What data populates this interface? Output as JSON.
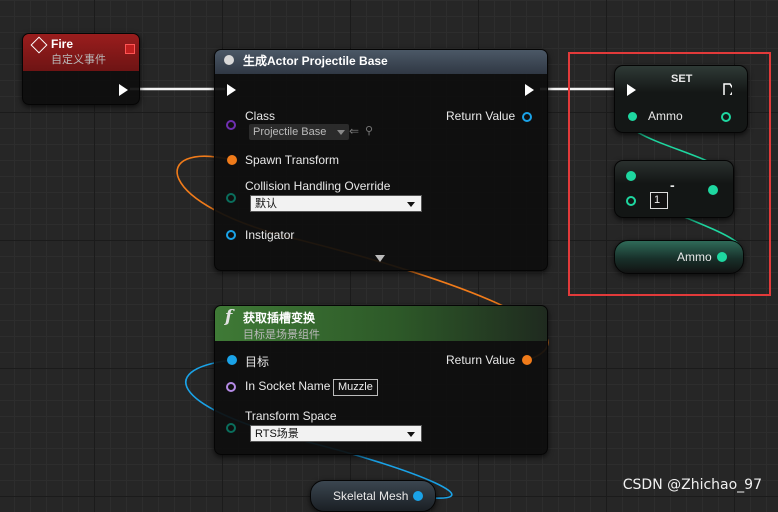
{
  "fire_node": {
    "title": "Fire",
    "subtitle": "自定义事件"
  },
  "spawn_node": {
    "title": "生成Actor Projectile Base",
    "class_label": "Class",
    "class_value": "Projectile Base",
    "return_label": "Return Value",
    "spawn_transform_label": "Spawn Transform",
    "collision_label": "Collision Handling Override",
    "collision_value": "默认",
    "instigator_label": "Instigator"
  },
  "socket_node": {
    "title": "获取插槽变换",
    "subtitle": "目标是场景组件",
    "target_label": "目标",
    "return_label": "Return Value",
    "socket_label": "In Socket Name",
    "socket_value": "Muzzle",
    "transform_label": "Transform Space",
    "transform_value": "RTS场景"
  },
  "set_node": {
    "title": "SET",
    "ammo_label": "Ammo"
  },
  "subtract_node": {
    "operator": "-",
    "input_value": "1"
  },
  "ammo_get_node": {
    "label": "Ammo"
  },
  "skeletal_node": {
    "label": "Skeletal Mesh"
  },
  "watermark": "CSDN @Zhichao_97",
  "colors": {
    "exec": "#ffffff",
    "event_header": "#8a1a1a",
    "int_pin": "#1ed7a0",
    "object_pin": "#1aa3e8",
    "struct_pin": "#f07b1a",
    "class_pin": "#6f2fb0",
    "name_pin": "#b58be6",
    "byte_pin": "#0a6e5c",
    "highlight": "#e23a3a"
  }
}
